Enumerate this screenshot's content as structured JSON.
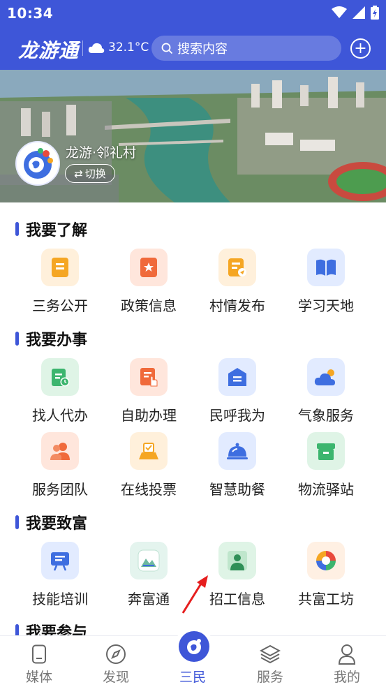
{
  "status_bar": {
    "time": "10:34"
  },
  "app_bar": {
    "logo": "龙游通",
    "temperature": "32.1°C",
    "search_placeholder": "搜索内容"
  },
  "banner": {
    "village_name": "龙游·邻礼村",
    "switch_label": "切换"
  },
  "sections": [
    {
      "title": "我要了解",
      "items": [
        {
          "label": "三务公开",
          "icon": "document-icon",
          "color": "#f5a623"
        },
        {
          "label": "政策信息",
          "icon": "star-document-icon",
          "color": "#f06a3b"
        },
        {
          "label": "村情发布",
          "icon": "announcement-icon",
          "color": "#f5a623"
        },
        {
          "label": "学习天地",
          "icon": "book-icon",
          "color": "#3e6ee0"
        }
      ]
    },
    {
      "title": "我要办事",
      "items": [
        {
          "label": "找人代办",
          "icon": "clipboard-clock-icon",
          "color": "#3cb56e"
        },
        {
          "label": "自助办理",
          "icon": "form-hand-icon",
          "color": "#f06a3b"
        },
        {
          "label": "民呼我为",
          "icon": "mailbox-icon",
          "color": "#3e6ee0"
        },
        {
          "label": "气象服务",
          "icon": "weather-cloud-icon",
          "color": "#3e6ee0"
        },
        {
          "label": "服务团队",
          "icon": "team-icon",
          "color": "#f06a3b"
        },
        {
          "label": "在线投票",
          "icon": "ballot-box-icon",
          "color": "#f5a623"
        },
        {
          "label": "智慧助餐",
          "icon": "meal-cloche-icon",
          "color": "#3e6ee0"
        },
        {
          "label": "物流驿站",
          "icon": "package-box-icon",
          "color": "#3cb56e"
        }
      ]
    },
    {
      "title": "我要致富",
      "items": [
        {
          "label": "技能培训",
          "icon": "training-board-icon",
          "color": "#3e6ee0"
        },
        {
          "label": "奔富通",
          "icon": "app-logo-icon",
          "color": "#3cb56e"
        },
        {
          "label": "招工信息",
          "icon": "worker-portrait-icon",
          "color": "#3cb56e"
        },
        {
          "label": "共富工坊",
          "icon": "workshop-logo-icon",
          "color": "#f06a3b"
        }
      ]
    },
    {
      "title": "我要参与"
    }
  ],
  "tab_bar": {
    "tabs": [
      {
        "label": "媒体",
        "icon": "phone-icon"
      },
      {
        "label": "发现",
        "icon": "compass-icon"
      },
      {
        "label": "三民",
        "icon": "sanmin-logo-icon",
        "active": true
      },
      {
        "label": "服务",
        "icon": "layers-icon"
      },
      {
        "label": "我的",
        "icon": "person-icon"
      }
    ]
  }
}
